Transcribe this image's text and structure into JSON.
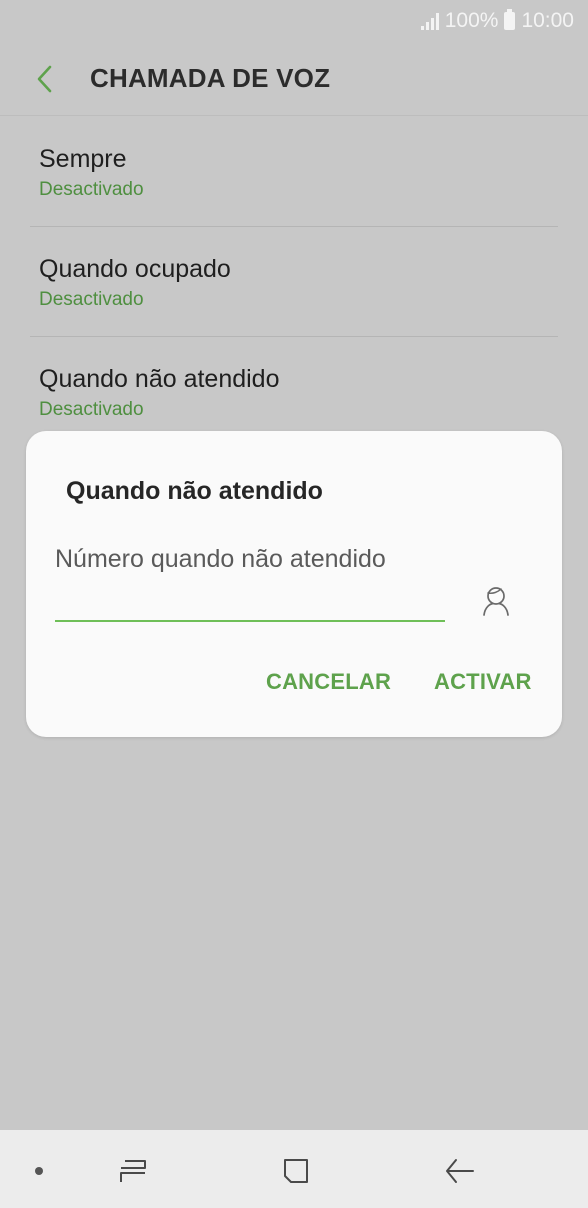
{
  "status_bar": {
    "battery_text": "100%",
    "time": "10:00"
  },
  "app_bar": {
    "title": "CHAMADA DE VOZ",
    "back_icon": "chevron-left-icon",
    "accent_color": "#5ea24c"
  },
  "list": {
    "items": [
      {
        "title": "Sempre",
        "status": "Desactivado"
      },
      {
        "title": "Quando ocupado",
        "status": "Desactivado"
      },
      {
        "title": "Quando não atendido",
        "status": "Desactivado"
      }
    ]
  },
  "dialog": {
    "title": "Quando não atendido",
    "input_value": "",
    "input_placeholder": "Número quando não atendido",
    "contact_icon": "person-icon",
    "cancel_label": "CANCELAR",
    "activate_label": "ACTIVAR"
  },
  "nav_bar": {
    "icons": [
      "dot-icon",
      "recents-icon",
      "home-icon",
      "back-arrow-icon"
    ]
  }
}
